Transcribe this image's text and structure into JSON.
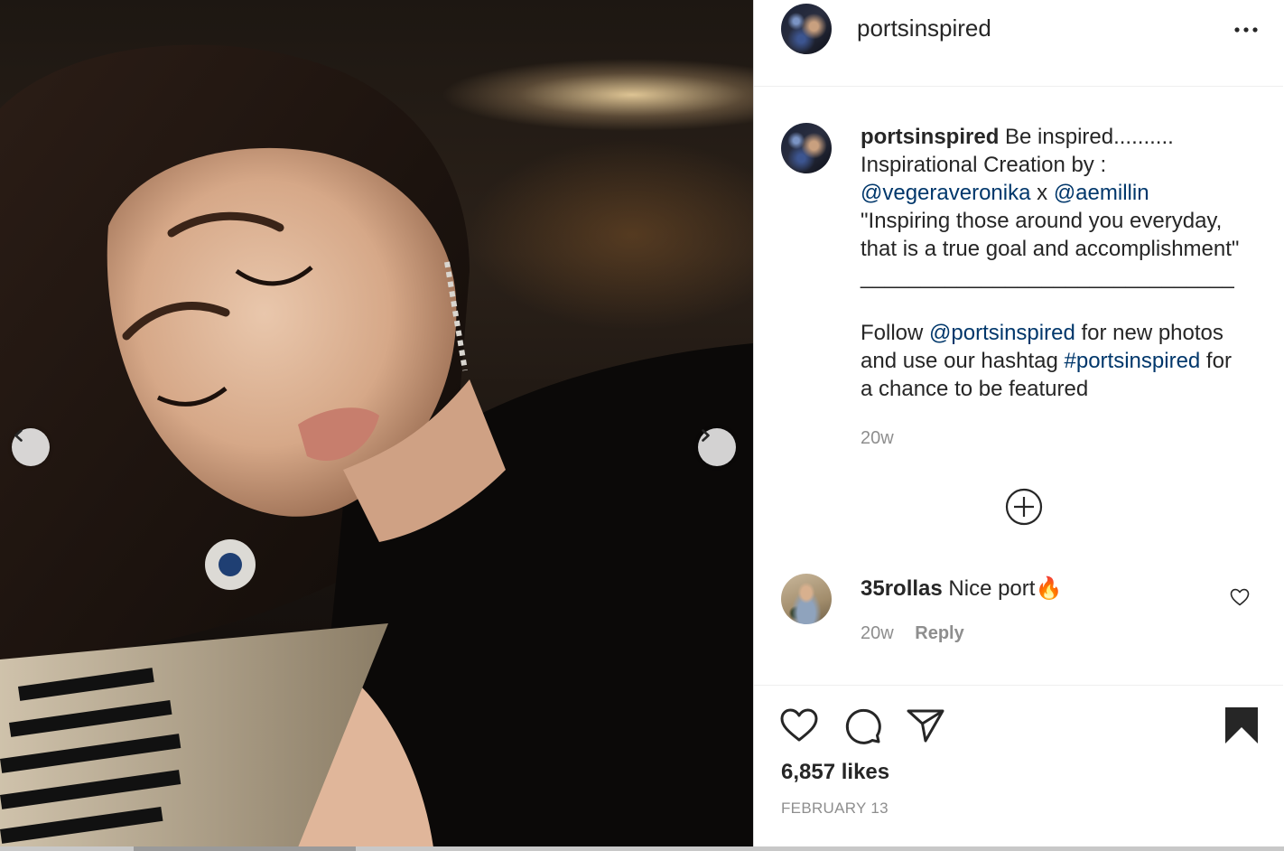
{
  "post": {
    "username": "portsinspired",
    "more_icon": "more-horizontal-icon"
  },
  "caption": {
    "username": "portsinspired",
    "line1": " Be inspired..........",
    "line2": "Inspirational Creation by :",
    "mention1": "@vegeraveronika",
    "x_text": " x ",
    "mention2": "@aemillin",
    "quote1": "\"Inspiring those around you everyday,",
    "quote2": "that is a true goal and accomplishment\"",
    "divider": "_______________________________",
    "follow_prefix": "Follow ",
    "follow_mention": "@portsinspired",
    "follow_suffix": " for new photos",
    "use_prefix": "and use our hashtag ",
    "hashtag": "#portsinspired",
    "use_suffix": " for",
    "last_line": "a chance to be featured",
    "time": "20w"
  },
  "load_more_icon": "plus-circle-icon",
  "comments": [
    {
      "username": "35rollas",
      "text": " Nice port🔥",
      "time": "20w",
      "reply_label": "Reply"
    }
  ],
  "actions": {
    "like_icon": "heart-icon",
    "comment_icon": "comment-icon",
    "share_icon": "paper-plane-icon",
    "save_icon": "bookmark-icon"
  },
  "likes": "6,857 likes",
  "date": "FEBRUARY 13",
  "carousel": {
    "prev_icon": "chevron-left-icon",
    "next_icon": "chevron-right-icon"
  },
  "colors": {
    "text": "#262626",
    "secondary": "#8e8e8e",
    "link": "#00376b",
    "border": "#dbdbdb"
  }
}
